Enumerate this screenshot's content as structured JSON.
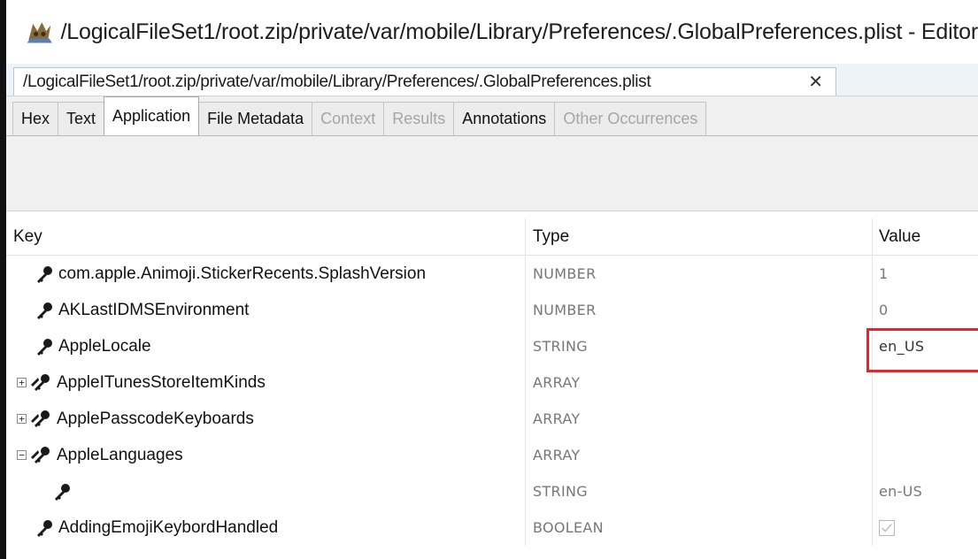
{
  "window": {
    "title": "/LogicalFileSet1/root.zip/private/var/mobile/Library/Preferences/.GlobalPreferences.plist - Editor"
  },
  "doc_tab": {
    "label": "/LogicalFileSet1/root.zip/private/var/mobile/Library/Preferences/.GlobalPreferences.plist",
    "close_glyph": "✕"
  },
  "view_tabs": [
    {
      "label": "Hex",
      "state": "enabled"
    },
    {
      "label": "Text",
      "state": "enabled"
    },
    {
      "label": "Application",
      "state": "active"
    },
    {
      "label": "File Metadata",
      "state": "enabled"
    },
    {
      "label": "Context",
      "state": "disabled"
    },
    {
      "label": "Results",
      "state": "disabled"
    },
    {
      "label": "Annotations",
      "state": "enabled"
    },
    {
      "label": "Other Occurrences",
      "state": "disabled"
    }
  ],
  "table": {
    "headers": {
      "key": "Key",
      "type": "Type",
      "value": "Value"
    },
    "rows": [
      {
        "key": "com.apple.Animoji.StickerRecents.SplashVersion",
        "type": "NUMBER",
        "value": "1",
        "icon": "key-icon",
        "expander": ""
      },
      {
        "key": "AKLastIDMSEnvironment",
        "type": "NUMBER",
        "value": "0",
        "icon": "key-icon",
        "expander": ""
      },
      {
        "key": "AppleLocale",
        "type": "STRING",
        "value": "en_US",
        "icon": "key-icon",
        "expander": "",
        "highlighted": true
      },
      {
        "key": "AppleITunesStoreItemKinds",
        "type": "ARRAY",
        "value": "",
        "icon": "keys-icon",
        "expander": "+"
      },
      {
        "key": "ApplePasscodeKeyboards",
        "type": "ARRAY",
        "value": "",
        "icon": "keys-icon",
        "expander": "+"
      },
      {
        "key": "AppleLanguages",
        "type": "ARRAY",
        "value": "",
        "icon": "keys-icon",
        "expander": "−"
      },
      {
        "key": "",
        "type": "STRING",
        "value": "en-US",
        "icon": "key-icon",
        "expander": "",
        "child": true
      },
      {
        "key": "AddingEmojiKeybordHandled",
        "type": "BOOLEAN",
        "value": "",
        "icon": "key-icon",
        "expander": "",
        "checkbox": true
      }
    ]
  },
  "colors": {
    "highlight": "#e3262b",
    "tab_bar": "#f0f0f0"
  }
}
